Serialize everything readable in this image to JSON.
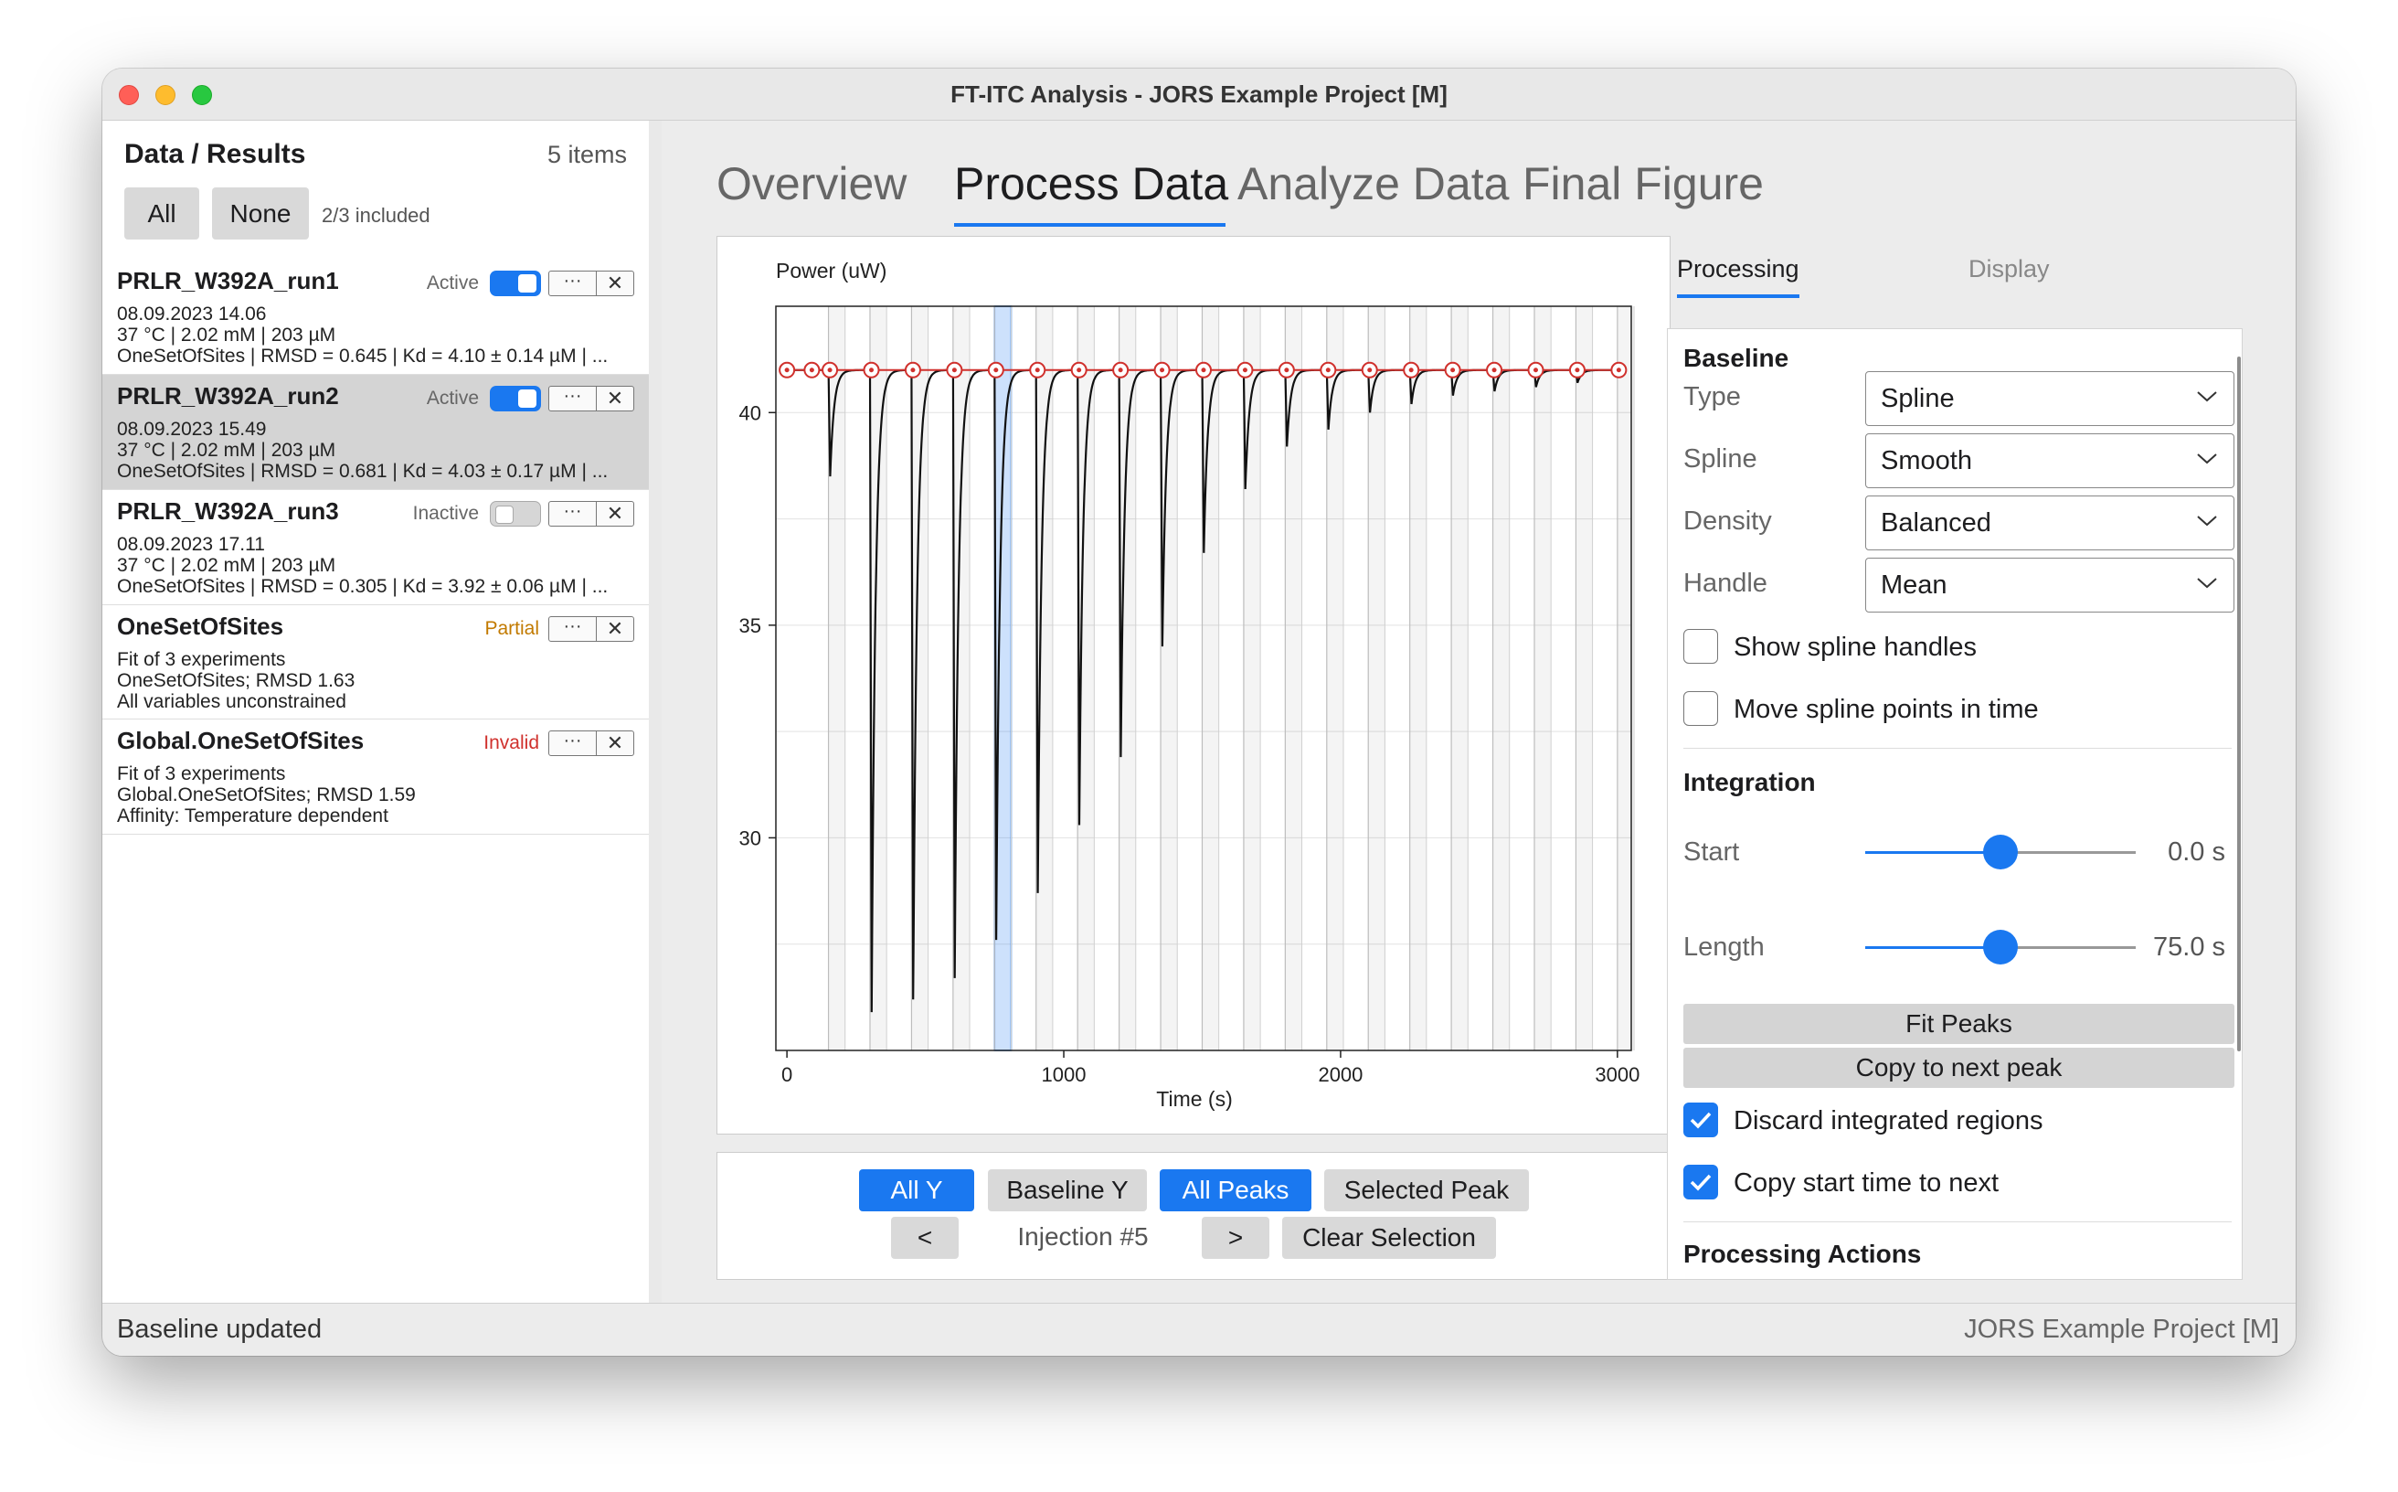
{
  "window": {
    "title": "FT-ITC Analysis - JORS Example Project [M]"
  },
  "left_panel": {
    "header": "Data / Results",
    "count": "5 items",
    "all_label": "All",
    "none_label": "None",
    "included_text": "2/3 included",
    "items": [
      {
        "name": "PRLR_W392A_run1",
        "status": "Active",
        "toggle": true,
        "lines": [
          "08.09.2023 14.06",
          "37 °C | 2.02 mM | 203 µM",
          "OneSetOfSites | RMSD = 0.645 | Kd = 4.10 ± 0.14 µM | ..."
        ]
      },
      {
        "name": "PRLR_W392A_run2",
        "status": "Active",
        "toggle": true,
        "lines": [
          "08.09.2023 15.49",
          "37 °C | 2.02 mM | 203 µM",
          "OneSetOfSites | RMSD = 0.681 | Kd = 4.03 ± 0.17 µM | ..."
        ]
      },
      {
        "name": "PRLR_W392A_run3",
        "status": "Inactive",
        "toggle": false,
        "lines": [
          "08.09.2023 17.11",
          "37 °C | 2.02 mM | 203 µM",
          "OneSetOfSites | RMSD = 0.305 | Kd = 3.92 ± 0.06 µM | ..."
        ]
      },
      {
        "name": "OneSetOfSites",
        "status": "Partial",
        "lines": [
          "Fit of 3 experiments",
          "OneSetOfSites; RMSD 1.63",
          "All variables unconstrained"
        ]
      },
      {
        "name": "Global.OneSetOfSites",
        "status": "Invalid",
        "lines": [
          "Fit of 3 experiments",
          "Global.OneSetOfSites; RMSD 1.59",
          "Affinity: Temperature dependent"
        ]
      }
    ]
  },
  "tabs": [
    "Overview",
    "Process Data",
    "Analyze Data",
    "Final Figure"
  ],
  "active_tab": "Process Data",
  "icons": {
    "more": "···",
    "close": "✕"
  },
  "chart_data": {
    "type": "line",
    "ylabel": "Power (uW)",
    "xlabel": "Time (s)",
    "xlim": [
      -40,
      3050
    ],
    "ylim": [
      25,
      42.5
    ],
    "xticks": [
      0,
      1000,
      2000,
      3000
    ],
    "yticks": [
      30,
      35,
      40
    ],
    "baseline_y": 41.0,
    "injection_times": [
      150,
      300,
      450,
      600,
      750,
      900,
      1050,
      1200,
      1350,
      1500,
      1650,
      1800,
      1950,
      2100,
      2250,
      2400,
      2550,
      2700,
      2850,
      3000
    ],
    "peak_min_y": [
      38.5,
      25.9,
      26.2,
      26.7,
      27.6,
      28.7,
      30.3,
      31.9,
      34.5,
      36.7,
      38.2,
      39.2,
      39.6,
      40.0,
      40.2,
      40.4,
      40.5,
      40.6,
      40.7,
      40.8
    ],
    "baseline_points_x": [
      155,
      305,
      455,
      605,
      755,
      905,
      1055,
      1205,
      1355,
      1505,
      1655,
      1805,
      1955,
      2105,
      2255,
      2405,
      2555,
      2705,
      2855,
      3005
    ],
    "selected_injection_index": 4,
    "grid": true,
    "colors": {
      "trace": "#111111",
      "baseline": "#d0312d",
      "selection": "#1a78f0"
    }
  },
  "controls": {
    "all_y": "All Y",
    "baseline_y": "Baseline Y",
    "all_peaks": "All Peaks",
    "selected_peak": "Selected Peak",
    "prev": "<",
    "injection_label": "Injection #5",
    "next": ">",
    "clear_selection": "Clear Selection"
  },
  "settings": {
    "tabs": [
      "Processing",
      "Display"
    ],
    "baseline_title": "Baseline",
    "type_label": "Type",
    "type_value": "Spline",
    "spline_label": "Spline",
    "spline_value": "Smooth",
    "density_label": "Density",
    "density_value": "Balanced",
    "handle_label": "Handle",
    "handle_value": "Mean",
    "show_handles": "Show spline handles",
    "move_points": "Move spline points in time",
    "integration_title": "Integration",
    "start_label": "Start",
    "start_value": "0.0 s",
    "start_fraction": 0.5,
    "length_label": "Length",
    "length_value": "75.0 s",
    "length_fraction": 0.5,
    "fit_peaks": "Fit Peaks",
    "copy_next_peak": "Copy to next peak",
    "discard_regions": "Discard integrated regions",
    "copy_start_time": "Copy start time to next",
    "processing_actions": "Processing Actions"
  },
  "status": {
    "left": "Baseline updated",
    "right": "JORS Example Project [M]"
  }
}
